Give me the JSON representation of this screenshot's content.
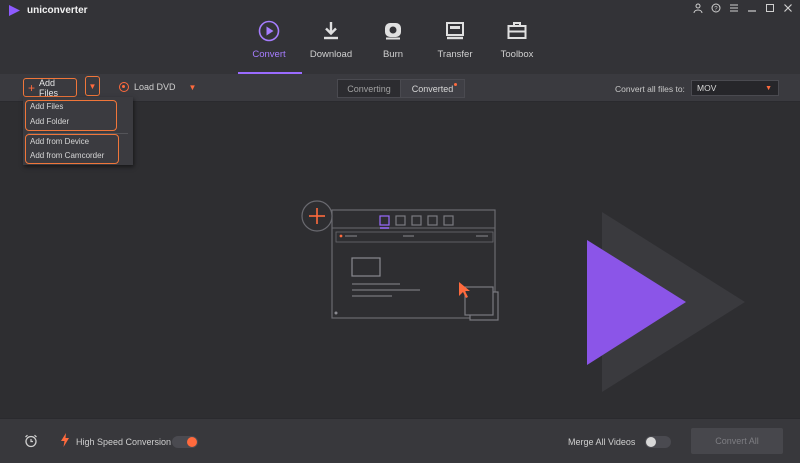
{
  "app": {
    "title": "uniconverter",
    "window_controls": [
      "person-icon",
      "help-icon",
      "menu-icon",
      "minimize-icon",
      "maximize-icon",
      "close-icon"
    ]
  },
  "nav": {
    "items": [
      {
        "label": "Convert",
        "icon": "convert-icon",
        "active": true
      },
      {
        "label": "Download",
        "icon": "download-icon",
        "active": false
      },
      {
        "label": "Burn",
        "icon": "burn-icon",
        "active": false
      },
      {
        "label": "Transfer",
        "icon": "transfer-icon",
        "active": false
      },
      {
        "label": "Toolbox",
        "icon": "toolbox-icon",
        "active": false
      }
    ]
  },
  "toolbar": {
    "add_files_label": "Add Files",
    "load_dvd_label": "Load DVD",
    "tabs": [
      {
        "label": "Converting",
        "active": false
      },
      {
        "label": "Converted",
        "active": true,
        "has_notification": true
      }
    ],
    "convert_all_label": "Convert all files to:",
    "format_value": "MOV"
  },
  "add_menu": {
    "items": [
      "Add Files",
      "Add Folder",
      "Add from Device",
      "Add from Camcorder"
    ]
  },
  "bottom": {
    "high_speed_label": "High Speed Conversion",
    "high_speed_on": true,
    "merge_label": "Merge All Videos",
    "merge_on": false,
    "convert_all_button": "Convert All"
  },
  "colors": {
    "accent_orange": "#ff6a3d",
    "accent_purple": "#9a6bff",
    "background": "#2e2e31"
  }
}
